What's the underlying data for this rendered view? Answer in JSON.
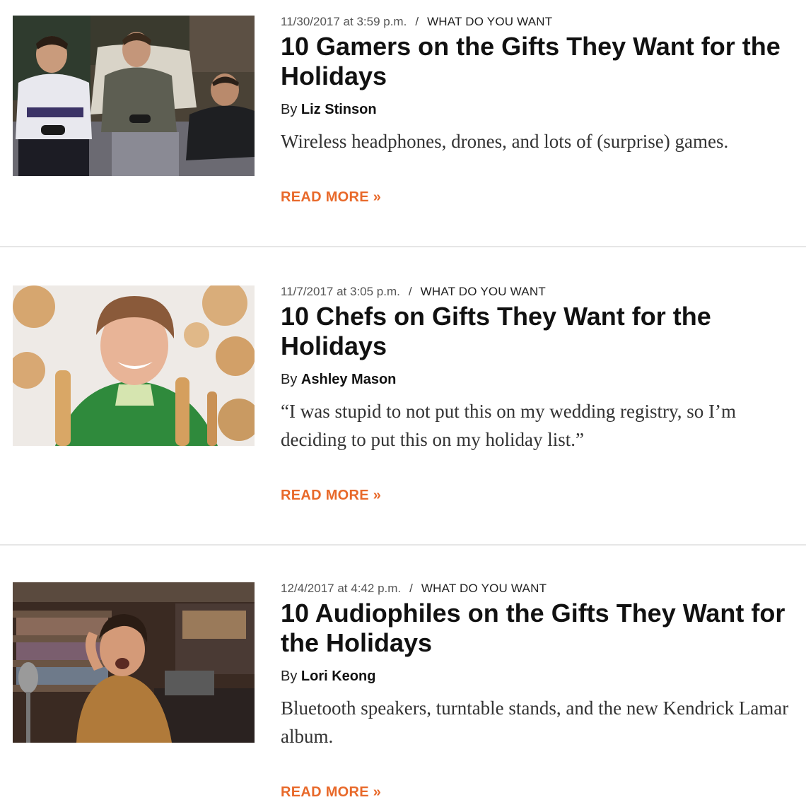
{
  "articles": [
    {
      "date": "11/30/2017 at 3:59 p.m.",
      "separator": "/",
      "section": "WHAT DO YOU WANT",
      "title": "10 Gamers on the Gifts They Want for the Holidays",
      "by_label": "By",
      "author": "Liz Stinson",
      "dek": "Wireless headphones, drones, and lots of (surprise) games.",
      "read_more": "READ MORE »"
    },
    {
      "date": "11/7/2017 at 3:05 p.m.",
      "separator": "/",
      "section": "WHAT DO YOU WANT",
      "title": "10 Chefs on Gifts They Want for the Holidays",
      "by_label": "By",
      "author": "Ashley Mason",
      "dek": "“I was stupid to not put this on my wedding registry, so I’m deciding to put this on my holiday list.”",
      "read_more": "READ MORE »"
    },
    {
      "date": "12/4/2017 at 4:42 p.m.",
      "separator": "/",
      "section": "WHAT DO YOU WANT",
      "title": "10 Audiophiles on the Gifts They Want for the Holidays",
      "by_label": "By",
      "author": "Lori Keong",
      "dek": "Bluetooth speakers, turntable stands, and the new Kendrick Lamar album.",
      "read_more": "READ MORE »"
    }
  ],
  "colors": {
    "accent": "#e8692a",
    "divider": "#e6e6e6",
    "meta": "#555555"
  }
}
